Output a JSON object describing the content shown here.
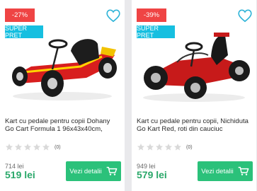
{
  "colors": {
    "discount": "#ef4444",
    "super_pret": "#16bfe0",
    "price": "#2aa86a",
    "button": "#2bc17a",
    "heart": "#2fb4d8"
  },
  "products": [
    {
      "discount": "-27%",
      "super_label": "SUPER PRET",
      "title": "Kart cu pedale pentru copii Dohany Go Cart Formula 1 96x43x40cm,",
      "rating": 0,
      "review_count": "(0)",
      "old_price": "714 lei",
      "price": "519 lei",
      "button_label": "Vezi detalii",
      "image_icon": "red-pedal-go-kart-f1"
    },
    {
      "discount": "-39%",
      "super_label": "SUPER PRET",
      "title": "Kart cu pedale pentru copii, Nichiduta Go Kart Red, roti din cauciuc",
      "rating": 0,
      "review_count": "(0)",
      "old_price": "949 lei",
      "price": "579 lei",
      "button_label": "Vezi detalii",
      "image_icon": "red-pedal-go-kart-seat"
    }
  ]
}
